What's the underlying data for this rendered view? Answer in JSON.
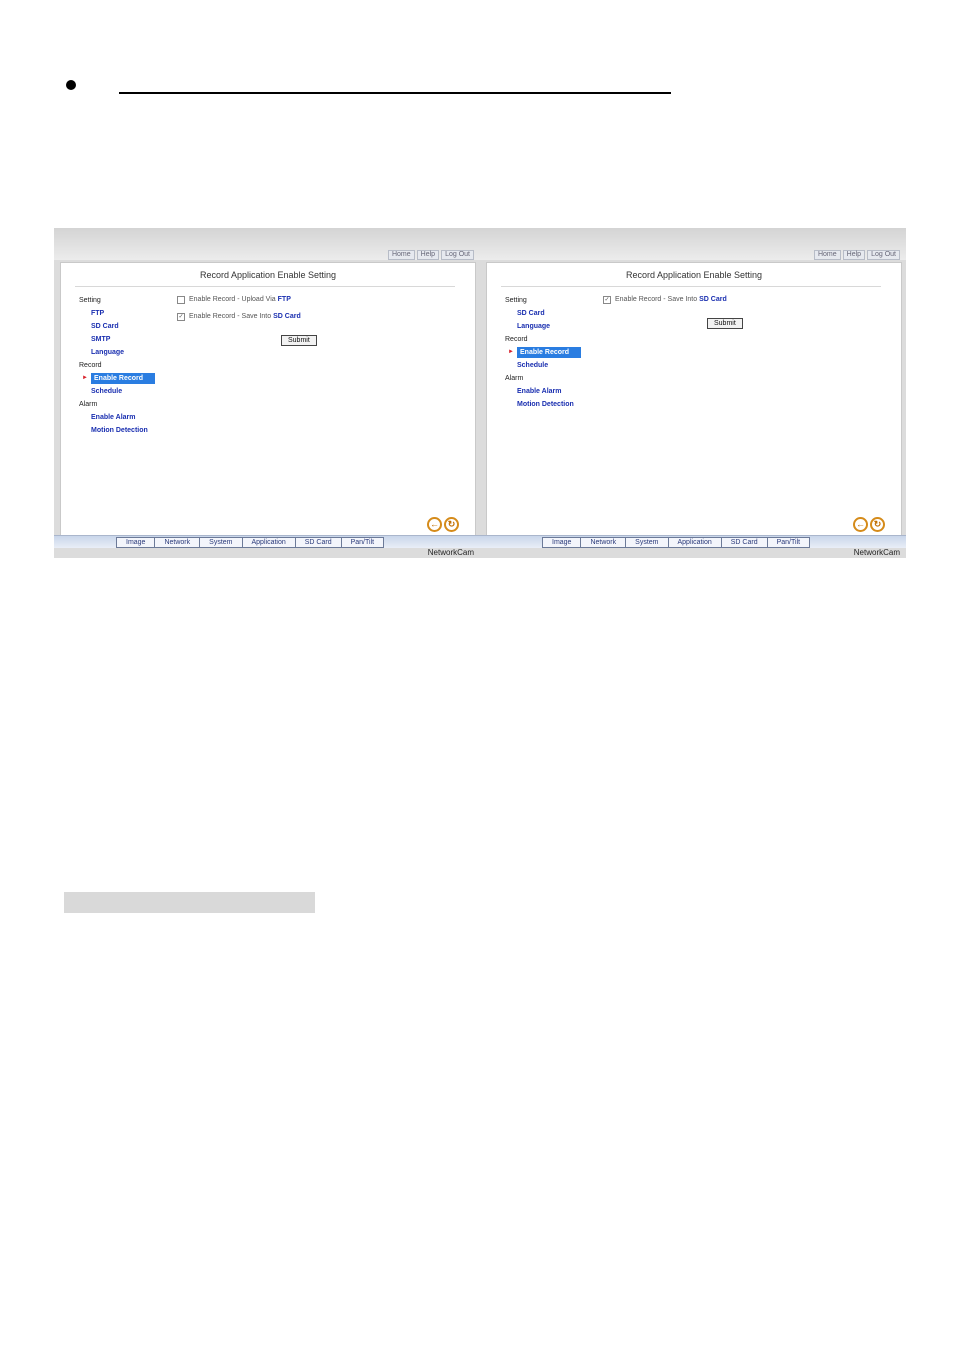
{
  "left_screen": {
    "top_links": [
      "Home",
      "Help",
      "Log Out"
    ],
    "title": "Record Application Enable Setting",
    "menu": [
      {
        "label": "Setting",
        "level": 0
      },
      {
        "label": "FTP",
        "level": 1
      },
      {
        "label": "SD Card",
        "level": 1
      },
      {
        "label": "SMTP",
        "level": 1
      },
      {
        "label": "Language",
        "level": 1
      },
      {
        "label": "Record",
        "level": 0
      },
      {
        "label": "Enable Record",
        "level": 1,
        "selected": true
      },
      {
        "label": "Schedule",
        "level": 1
      },
      {
        "label": "Alarm",
        "level": 0
      },
      {
        "label": "Enable Alarm",
        "level": 1
      },
      {
        "label": "Motion Detection",
        "level": 1
      }
    ],
    "options": [
      {
        "text": "Enable Record - Upload Via",
        "link": "FTP",
        "checked": false
      },
      {
        "text": "Enable Record - Save Into",
        "link": "SD Card",
        "checked": true
      }
    ],
    "submit_label": "Submit",
    "tabs": [
      "Image",
      "Network",
      "System",
      "Application",
      "SD Card",
      "Pan/Tilt"
    ],
    "brand": "NetworkCam"
  },
  "right_screen": {
    "top_links": [
      "Home",
      "Help",
      "Log Out"
    ],
    "title": "Record Application Enable Setting",
    "menu": [
      {
        "label": "Setting",
        "level": 0
      },
      {
        "label": "SD Card",
        "level": 1
      },
      {
        "label": "Language",
        "level": 1
      },
      {
        "label": "Record",
        "level": 0
      },
      {
        "label": "Enable Record",
        "level": 1,
        "selected": true
      },
      {
        "label": "Schedule",
        "level": 1
      },
      {
        "label": "Alarm",
        "level": 0
      },
      {
        "label": "Enable Alarm",
        "level": 1
      },
      {
        "label": "Motion Detection",
        "level": 1
      }
    ],
    "options": [
      {
        "text": "Enable Record - Save Into",
        "link": "SD Card",
        "checked": true
      }
    ],
    "submit_label": "Submit",
    "tabs": [
      "Image",
      "Network",
      "System",
      "Application",
      "SD Card",
      "Pan/Tilt"
    ],
    "brand": "NetworkCam"
  }
}
